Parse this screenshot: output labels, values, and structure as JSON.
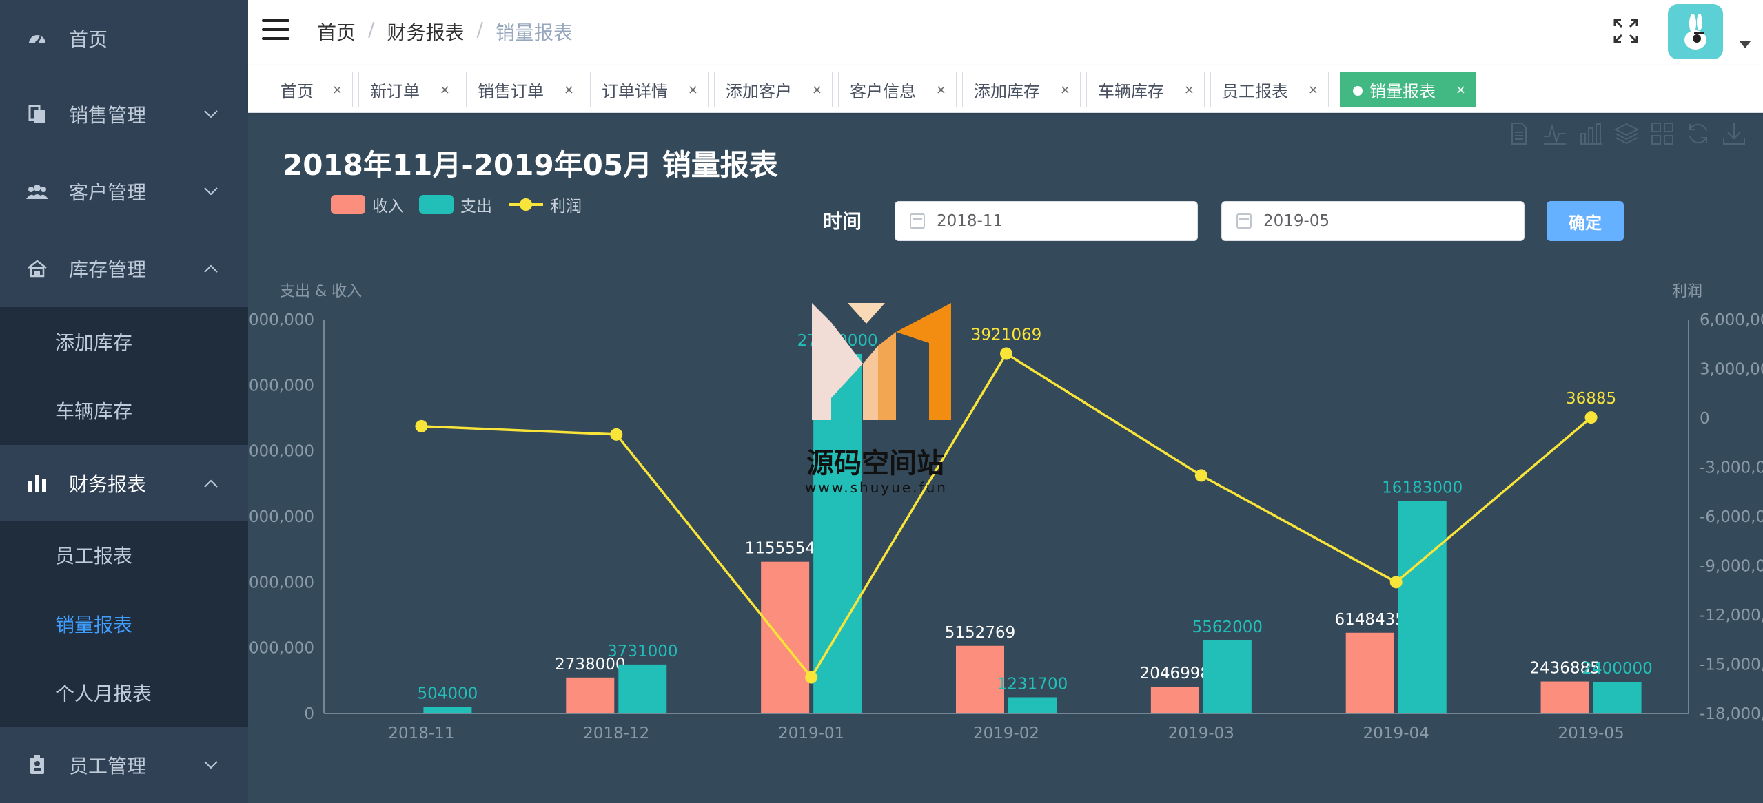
{
  "sidebar": {
    "items": [
      {
        "label": "首页"
      },
      {
        "label": "销售管理"
      },
      {
        "label": "客户管理"
      },
      {
        "label": "库存管理"
      },
      {
        "label": "财务报表"
      },
      {
        "label": "员工管理"
      }
    ],
    "inventory_sub": [
      {
        "label": "添加库存"
      },
      {
        "label": "车辆库存"
      }
    ],
    "finance_sub": [
      {
        "label": "员工报表"
      },
      {
        "label": "销量报表",
        "active": true
      },
      {
        "label": "个人月报表"
      }
    ],
    "active_color": "#409eff"
  },
  "breadcrumb": [
    "首页",
    "财务报表",
    "销量报表"
  ],
  "tags": [
    {
      "label": "首页"
    },
    {
      "label": "新订单"
    },
    {
      "label": "销售订单"
    },
    {
      "label": "订单详情"
    },
    {
      "label": "添加客户"
    },
    {
      "label": "客户信息"
    },
    {
      "label": "添加库存"
    },
    {
      "label": "车辆库存"
    },
    {
      "label": "员工报表"
    },
    {
      "label": "销量报表",
      "active": true
    }
  ],
  "tag_close_symbol": "×",
  "filter": {
    "time_label": "时间",
    "start": "2018-11",
    "end": "2019-05",
    "confirm_label": "确定"
  },
  "watermark": {
    "text": "源码空间站",
    "url": "www.shuyue.fun"
  },
  "chart_data": {
    "type": "bar",
    "title": "2018年11月-2019年05月 销量报表",
    "legend": [
      "收入",
      "支出",
      "利润"
    ],
    "legend_placement": "top-left",
    "categories": [
      "2018-11",
      "2018-12",
      "2019-01",
      "2019-02",
      "2019-03",
      "2019-04",
      "2019-05"
    ],
    "ylabel_left": "支出 & 收入",
    "ylabel_right": "利润",
    "y_left_ticks_visible": [
      "0",
      "000,000",
      "000,000",
      "000,000",
      "000,000",
      "000,000",
      "000,000"
    ],
    "y_right_ticks": [
      "6,000,00",
      "3,000,00",
      "0",
      "-3,000,0",
      "-6,000,0",
      "-9,000,0",
      "-12,000,",
      "-15,000,",
      "-18,000,"
    ],
    "ylim_left": [
      0,
      30000000
    ],
    "ylim_right": [
      -18000000,
      6000000
    ],
    "grid": false,
    "series": [
      {
        "name": "收入",
        "type": "bar",
        "color": "#fc8e7d",
        "values": [
          0,
          2738000,
          11555544,
          5152769,
          2046998,
          6148435,
          2436885
        ],
        "labels": [
          "",
          "2738000",
          "11555544",
          "5152769",
          "2046998",
          "6148435",
          "2436885"
        ]
      },
      {
        "name": "支出",
        "type": "bar",
        "color": "#22bfb8",
        "values": [
          504000,
          3731000,
          27380000,
          1231700,
          5562000,
          16183000,
          2400000
        ],
        "labels": [
          "504000",
          "3731000",
          "27380000",
          "1231700",
          "5562000",
          "16183000",
          "2400000"
        ]
      },
      {
        "name": "利润",
        "type": "line",
        "color": "#f9e439",
        "values": [
          -500000,
          -1000000,
          -15800000,
          3921069,
          -3500000,
          -10000000,
          36885
        ],
        "labels": [
          "",
          "",
          "",
          "3921069",
          "",
          "",
          "36885"
        ]
      }
    ]
  },
  "colors": {
    "background": "#34495a",
    "sidebar": "#304156",
    "submenu": "#1f2d3d",
    "tag_active": "#42b983",
    "button": "#66b1ff"
  }
}
